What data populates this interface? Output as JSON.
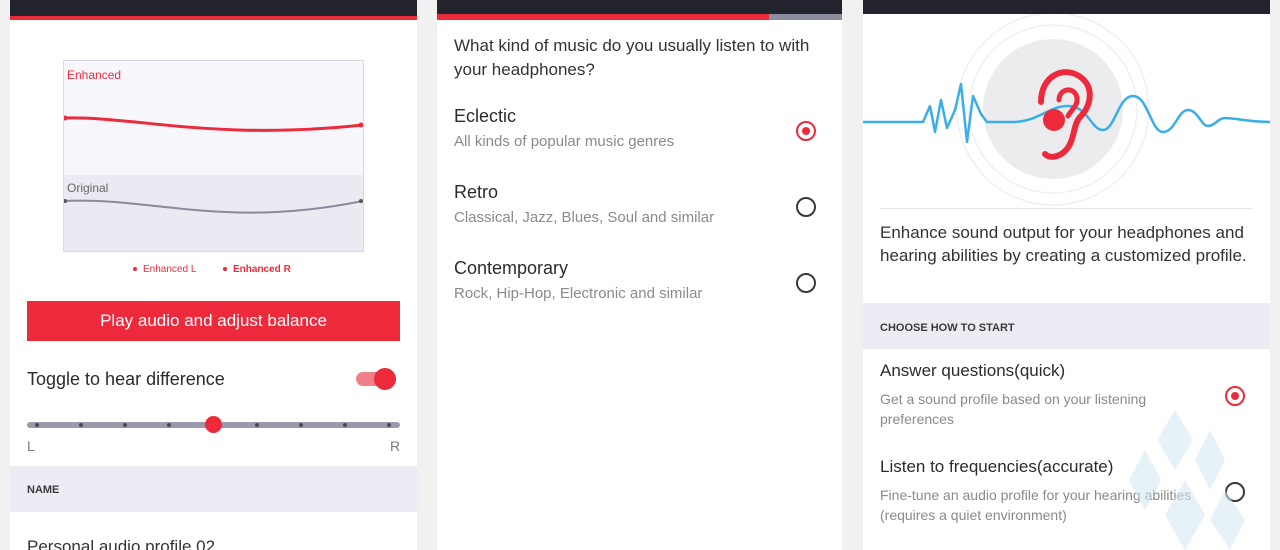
{
  "colors": {
    "accent": "#ed2a3c",
    "topbar": "#22232c",
    "wave_blue": "#3aaee8"
  },
  "panel1": {
    "chart": {
      "enhanced_label": "Enhanced",
      "original_label": "Original"
    },
    "legend": {
      "left": "Enhanced L",
      "right": "Enhanced R"
    },
    "play_button": "Play audio and adjust balance",
    "toggle_label": "Toggle to hear difference",
    "toggle_on": true,
    "balance": {
      "left_label": "L",
      "right_label": "R",
      "position": 0.5
    },
    "name_header": "NAME",
    "profile_name": "Personal audio profile 02"
  },
  "panel2": {
    "progress": 0.82,
    "question": "What kind of music do you usually listen to with your headphones?",
    "options": [
      {
        "title": "Eclectic",
        "subtitle": "All kinds of popular music genres",
        "selected": true
      },
      {
        "title": "Retro",
        "subtitle": "Classical, Jazz, Blues, Soul and similar",
        "selected": false
      },
      {
        "title": "Contemporary",
        "subtitle": "Rock, Hip-Hop, Electronic and similar",
        "selected": false
      }
    ]
  },
  "panel3": {
    "hero_icon": "ear-icon",
    "intro": "Enhance sound output for your headphones and hearing abilities by creating a customized profile.",
    "choose_header": "CHOOSE HOW TO START",
    "options": [
      {
        "title": "Answer questions(quick)",
        "subtitle": "Get a sound profile based on your listening preferences",
        "selected": true
      },
      {
        "title": "Listen to frequencies(accurate)",
        "subtitle": "Fine-tune an audio profile for your hearing abilities (requires a quiet environment)",
        "selected": false
      }
    ]
  }
}
